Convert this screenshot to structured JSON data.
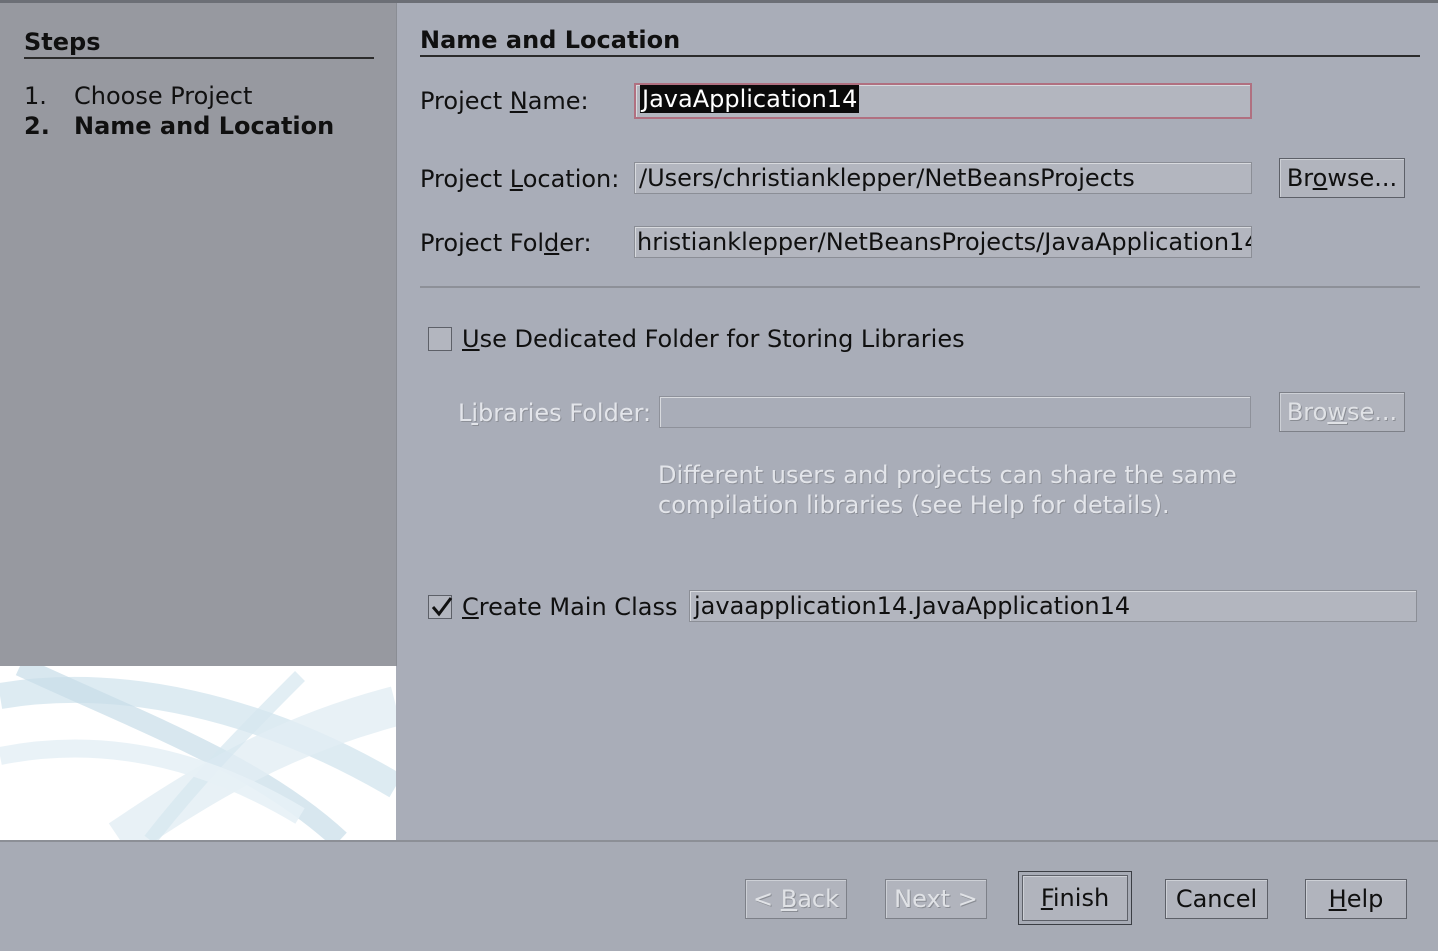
{
  "steps": {
    "title": "Steps",
    "items": [
      {
        "num": "1.",
        "label": "Choose Project"
      },
      {
        "num": "2.",
        "label": "Name and Location"
      }
    ]
  },
  "main": {
    "title": "Name and Location",
    "project_name": {
      "label_pre": "Project ",
      "label_key": "N",
      "label_post": "ame:",
      "value": "JavaApplication14"
    },
    "project_location": {
      "label_pre": "Project ",
      "label_key": "L",
      "label_post": "ocation:",
      "value": "/Users/christianklepper/NetBeansProjects"
    },
    "project_folder": {
      "label_pre": "Project Fol",
      "label_key": "d",
      "label_post": "er:",
      "value": "hristianklepper/NetBeansProjects/JavaApplication14"
    },
    "browse1": {
      "pre": "Br",
      "key": "o",
      "post": "wse..."
    },
    "dedicated_folder": {
      "key": "U",
      "rest": "se Dedicated Folder for Storing Libraries",
      "checked": false
    },
    "libraries_folder": {
      "pre": "L",
      "key": "i",
      "post": "braries Folder:",
      "value": ""
    },
    "browse2": {
      "pre": "Bro",
      "key": "w",
      "post": "se..."
    },
    "hint": "Different users and projects can share the same compilation libraries (see Help for details).",
    "create_main": {
      "key": "C",
      "rest": "reate Main Class",
      "checked": true,
      "value": "javaapplication14.JavaApplication14"
    }
  },
  "buttons": {
    "back": {
      "pre": "< ",
      "key": "B",
      "post": "ack"
    },
    "next": "Next >",
    "finish": {
      "key": "F",
      "post": "inish"
    },
    "cancel": "Cancel",
    "help": {
      "key": "H",
      "post": "elp"
    }
  }
}
